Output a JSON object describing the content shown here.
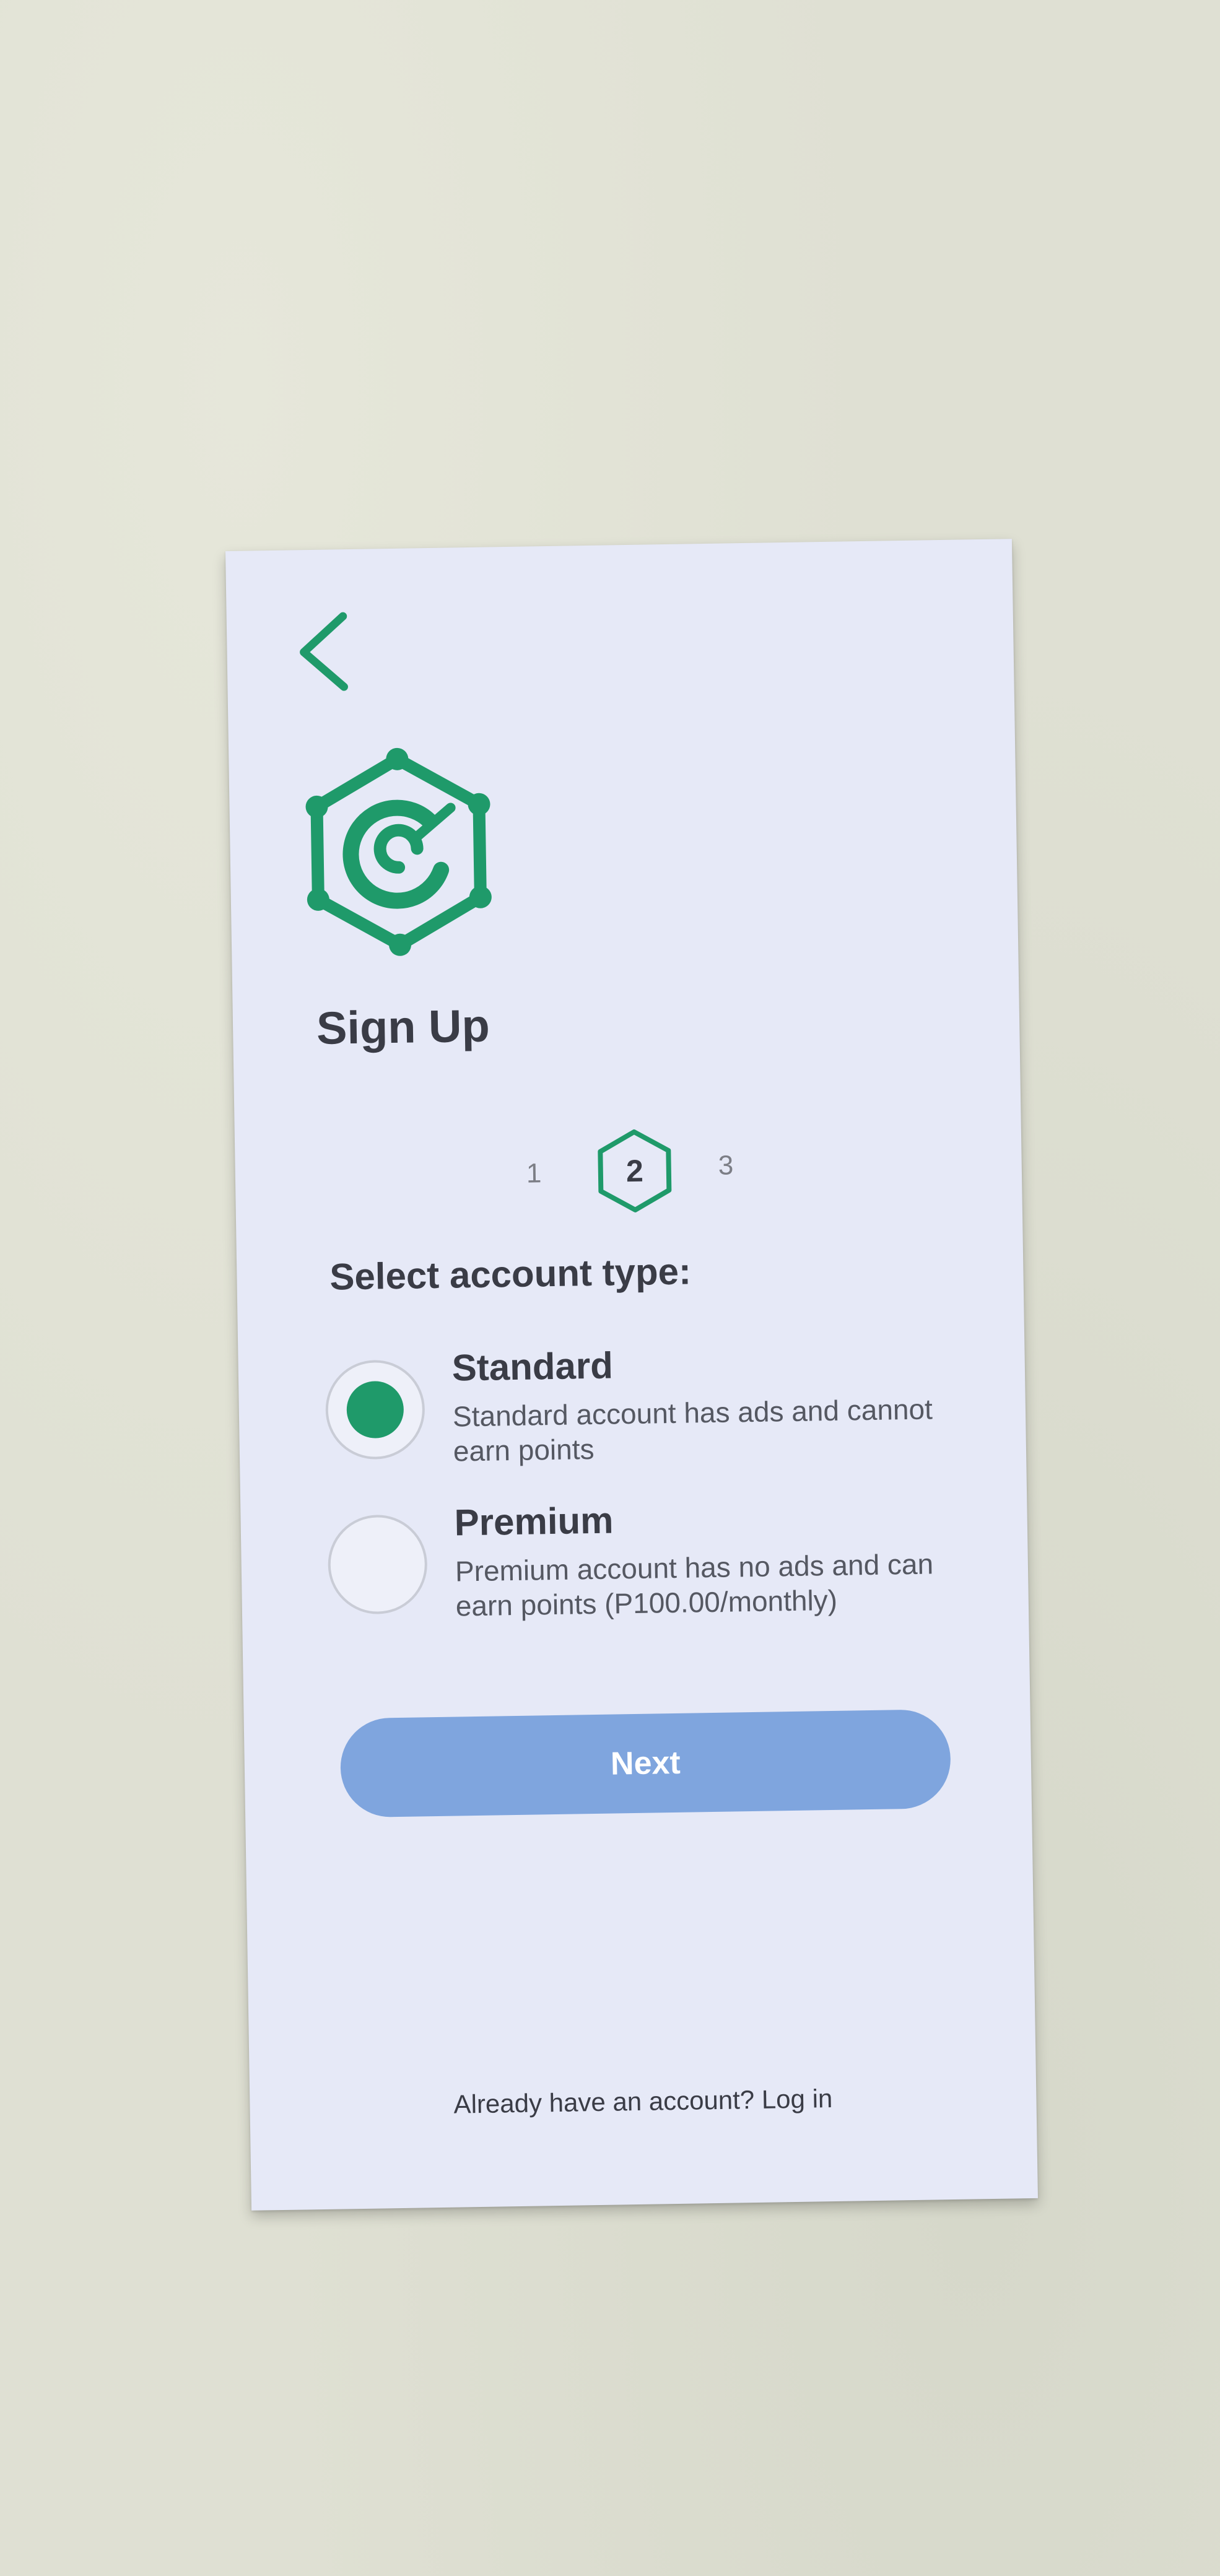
{
  "header": {
    "back_icon": "chevron-left-icon",
    "logo_icon": "hexagon-c-logo-icon",
    "title": "Sign Up"
  },
  "stepper": {
    "steps": [
      "1",
      "2",
      "3"
    ],
    "current_step": "2"
  },
  "account_type": {
    "heading": "Select account type:",
    "selected": "Standard",
    "options": [
      {
        "title": "Standard",
        "description": "Standard account has ads and cannot earn points"
      },
      {
        "title": "Premium",
        "description": "Premium account has no ads and can earn points (P100.00/monthly)"
      }
    ]
  },
  "actions": {
    "next_label": "Next"
  },
  "footer": {
    "login_prompt": "Already have an account? Log in"
  },
  "colors": {
    "brand_green": "#1f9a6a",
    "button_blue": "#7fa5de",
    "text_dark": "#3a3c46",
    "paper": "#e6e9f7"
  }
}
